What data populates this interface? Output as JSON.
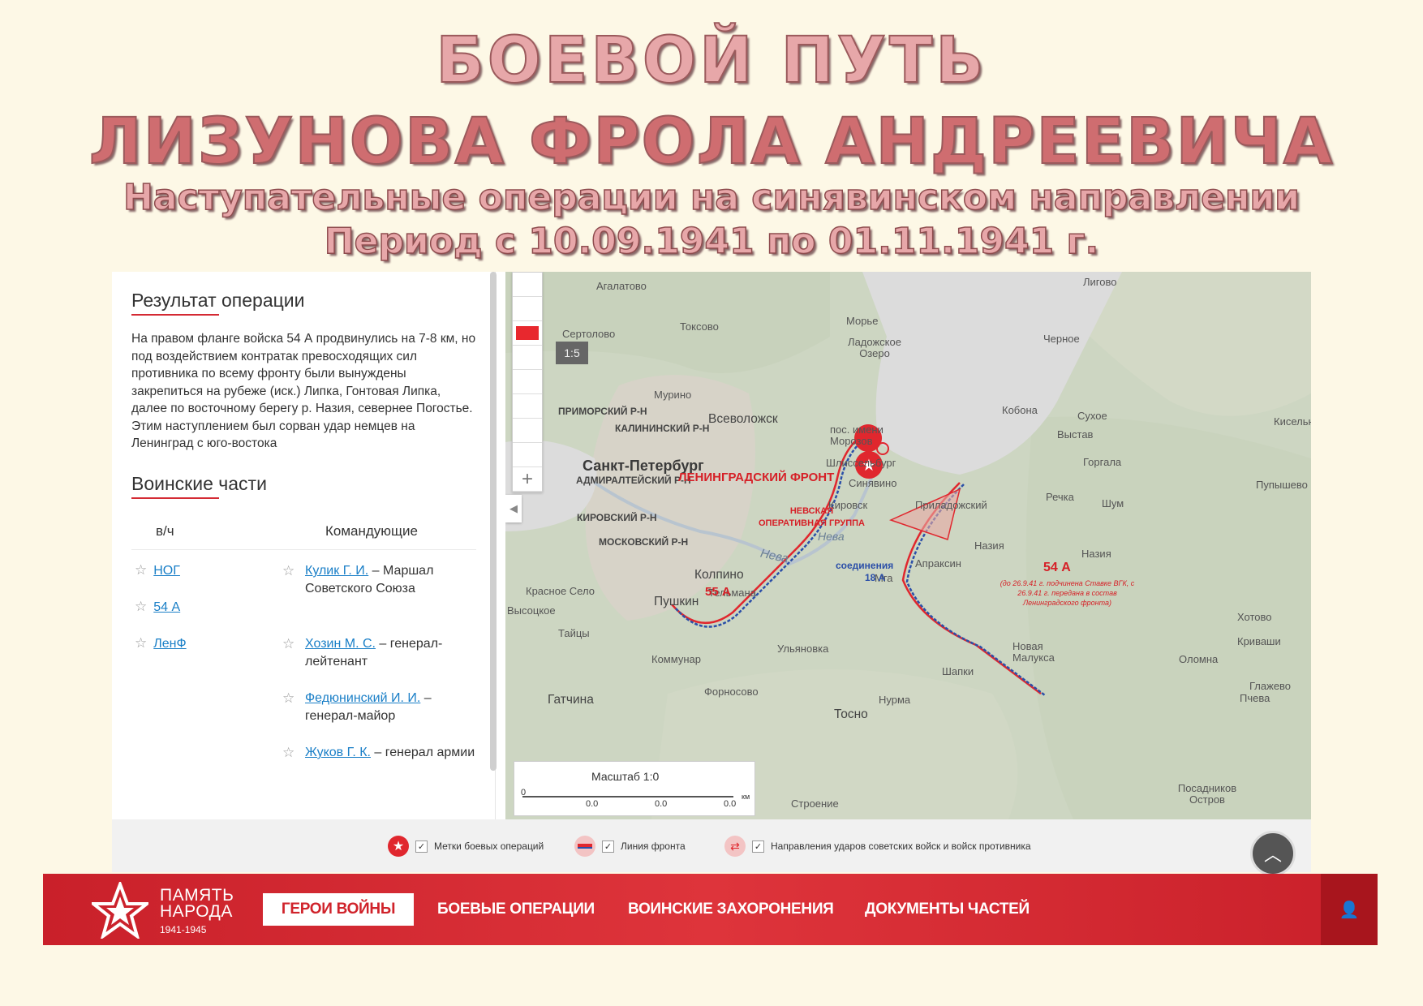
{
  "slide": {
    "title_line1": "БОЕВОЙ ПУТЬ",
    "title_line2": "ЛИЗУНОВА ФРОЛА АНДРЕЕВИЧА",
    "subtitle_line1": "Наступательные операции на синявинском направлении",
    "subtitle_line2": "Период с 10.09.1941 по 01.11.1941 г."
  },
  "panel": {
    "result_title": "Результат операции",
    "result_text": "На правом фланге войска 54 А продвинулись на 7-8 км, но под воздействием контратак превосходящих сил противника по всему фронту были вынуждены закрепиться на рубеже (иск.) Липка, Гонтовая Липка, далее по восточному берегу р. Назия, севернее Погостье. Этим наступлением был сорван удар немцев на Ленинград с юго-востока",
    "units_title": "Воинские части",
    "col_unit": "в/ч",
    "col_commanders": "Командующие",
    "units": [
      "НОГ",
      "54 А",
      "ЛенФ"
    ],
    "commanders": [
      {
        "name": "Кулик Г. И.",
        "rank": "Маршал Советского Союза"
      },
      {
        "name": "Хозин М. С.",
        "rank": "генерал-лейтенант"
      },
      {
        "name": "Федюнинский И. И.",
        "rank": "генерал-майор"
      },
      {
        "name": "Жуков Г. К.",
        "rank": "генерал армии"
      }
    ]
  },
  "map": {
    "zoom_label": "1:5",
    "scale_title": "Масштаб 1:0",
    "scale_ticks": [
      "0",
      "0.0",
      "0.0",
      "0.0"
    ],
    "scale_unit": "км",
    "places": {
      "agalatovo": "Агалатово",
      "toksovo": "Токсово",
      "morye": "Морье",
      "ladoga": "Ладожское Озеро",
      "ligovo": "Лигово",
      "chernoe": "Черное",
      "sertolovo": "Сертолово",
      "murino": "Мурино",
      "vsevolozhsk": "Всеволожск",
      "primorsky": "ПРИМОРСКИЙ Р-Н",
      "kalininsky": "КАЛИНИНСКИЙ Р-Н",
      "kobona": "Кобона",
      "sukhoe": "Сухое",
      "vystav": "Выстав",
      "kiselnya": "Кисельн",
      "pos_morozov": "пос. имени Морозов",
      "shlisselburg": "Шлиссельбург",
      "spb": "Санкт-Петербург",
      "admiralteysky": "АДМИРАЛТЕЙСКИЙ Р-Н",
      "sinyavino": "Синявино",
      "kirovsk": "Кировск",
      "prila": "Приладожский",
      "gorgala": "Горгала",
      "pupyshevo": "Пупышево",
      "rechka": "Речка",
      "shum": "Шум",
      "kirovsky": "КИРОВСКИЙ Р-Н",
      "moskovsky": "МОСКОВСКИЙ Р-Н",
      "neva": "Нева",
      "neva2": "Нева",
      "nazia": "Назия",
      "nazia2": "Назия",
      "apraksin": "Апраксин",
      "kolpino": "Колпино",
      "mga": "Мга",
      "krasnoe": "Красное Село",
      "pushkin": "Пушкин",
      "telmana": "Тельмана",
      "vysotskoe": "Высоцкое",
      "taitsy": "Тайцы",
      "khotovo": "Хотово",
      "krivashi": "Криваши",
      "glazhevo": "Глажево",
      "kommunar": "Коммунар",
      "ulyanovka": "Ульяновка",
      "shapki": "Шапки",
      "novaya_malyuksa": "Новая Малукса",
      "olomna": "Оломна",
      "gatchina": "Гатчина",
      "fornosovo": "Форносово",
      "nurma": "Нурма",
      "pchevo": "Пчева",
      "tosno": "Тосно",
      "stroenie": "Строение",
      "posadnikov": "Посадников Остров"
    },
    "ops": {
      "lenfront": "ЛЕНИНГРАДСКИЙ ФРОНТ",
      "nog": "НЕВСКАЯ ОПЕРАТИВНАЯ ГРУППА",
      "a55": "55 А",
      "a54": "54 А",
      "a54_note": "(до 26.9.41 г. подчинена Ставке ВГК, с 26.9.41 г. передана в состав Ленинградского фронта)",
      "conn": "соединения",
      "a18": "18 А"
    },
    "colors": {
      "front_red": "#e0272e",
      "front_blue": "#2b4fa8",
      "water": "#dcdcdc"
    }
  },
  "legend": {
    "marks": "Метки боевых операций",
    "front_line": "Линия фронта",
    "strikes": "Направления ударов советских войск и войск противника"
  },
  "nav": {
    "logo_line1": "ПАМЯТЬ",
    "logo_line2": "НАРОДА",
    "logo_years": "1941-1945",
    "items": [
      "ГЕРОИ ВОЙНЫ",
      "БОЕВЫЕ ОПЕРАЦИИ",
      "ВОИНСКИЕ ЗАХОРОНЕНИЯ",
      "ДОКУМЕНТЫ ЧАСТЕЙ"
    ],
    "active_index": 0,
    "accent": "#d0232b"
  }
}
